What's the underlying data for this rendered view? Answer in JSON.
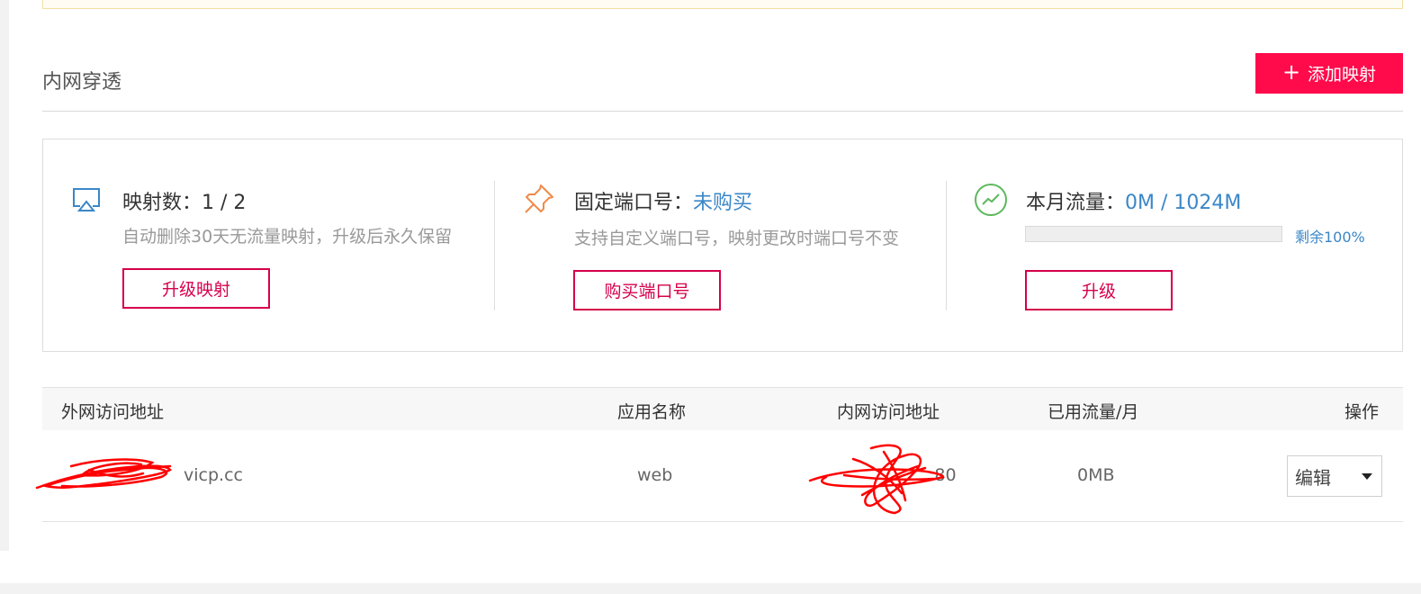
{
  "section": {
    "title": "内网穿透",
    "add_button": "添加映射"
  },
  "stats": [
    {
      "icon": "airplay-icon",
      "label": "映射数：",
      "value": "1 / 2",
      "desc": "自动删除30天无流量映射，升级后永久保留",
      "button": "升级映射"
    },
    {
      "icon": "pin-icon",
      "label": "固定端口号：",
      "value": "未购买",
      "desc": "支持自定义端口号，映射更改时端口号不变",
      "button": "购买端口号"
    },
    {
      "icon": "trend-icon",
      "label": "本月流量：",
      "value": "0M / 1024M",
      "remaining_label": "剩余100%",
      "remaining_fraction": 1.0,
      "button": "升级"
    }
  ],
  "table": {
    "headers": [
      "外网访问地址",
      "应用名称",
      "内网访问地址",
      "已用流量/月",
      "操作"
    ],
    "rows": [
      {
        "external": "vicp.cc",
        "app": "web",
        "internal": ":80",
        "traffic": "0MB",
        "action": "编辑"
      }
    ]
  },
  "colors": {
    "accent": "#ff0a4b",
    "outline": "#d6004b",
    "link": "#3a87c8",
    "redaction": "#ff0000"
  }
}
